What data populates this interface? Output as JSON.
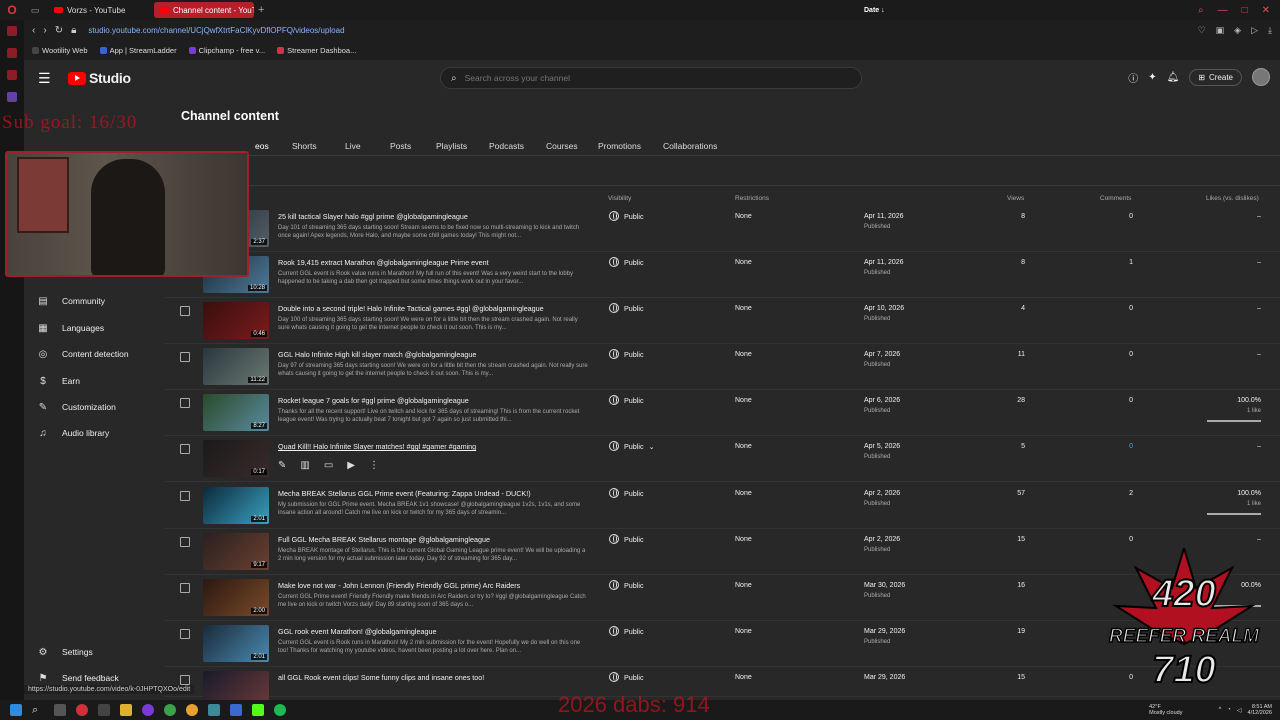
{
  "browser": {
    "tabs": [
      {
        "title": "Vorzs - YouTube"
      },
      {
        "title": "Channel content - YouTub"
      }
    ],
    "url": "studio.youtube.com/channel/UCjQwfXtrtFaClKyvDflOPFQ/videos/upload",
    "bookmarks": [
      "Wootility Web",
      "App | StreamLadder",
      "Clipchamp - free v...",
      "Streamer Dashboa..."
    ],
    "status_url": "https://studio.youtube.com/video/k-0JHPTQXOo/edit"
  },
  "header": {
    "brand": "Studio",
    "search_placeholder": "Search across your channel",
    "create_label": "Create"
  },
  "sidebar": {
    "items": [
      {
        "label": "Community",
        "icon": "community-icon"
      },
      {
        "label": "Languages",
        "icon": "languages-icon"
      },
      {
        "label": "Content detection",
        "icon": "content-detection-icon"
      },
      {
        "label": "Earn",
        "icon": "earn-icon"
      },
      {
        "label": "Customization",
        "icon": "customization-icon"
      },
      {
        "label": "Audio library",
        "icon": "audio-library-icon"
      }
    ],
    "settings": "Settings",
    "feedback": "Send feedback"
  },
  "page": {
    "title": "Channel content",
    "tabs": [
      "eos",
      "Shorts",
      "Live",
      "Posts",
      "Playlists",
      "Podcasts",
      "Courses",
      "Promotions",
      "Collaborations"
    ]
  },
  "columns": {
    "visibility": "Visibility",
    "restrictions": "Restrictions",
    "date": "Date",
    "views": "Views",
    "comments": "Comments",
    "likes": "Likes (vs. dislikes)"
  },
  "videos": [
    {
      "title": "25 kill tactical Slayer halo #ggl prime @globalgamingleague",
      "desc": "Day 101 of streaming 365 days starting soon! Stream seems to be fixed now so multi-streaming to kick and twitch once again! Apex legends, More Halo, and maybe some chill games today! This might not...",
      "duration": "2:37",
      "visibility": "Public",
      "restrictions": "None",
      "date": "Apr 11, 2026",
      "status": "Published",
      "views": "8",
      "comments": "0",
      "likes": "–",
      "likes_sub": ""
    },
    {
      "title": "Rook 19,415 extract Marathon @globalgamingleague Prime event",
      "desc": "Current GGL event is Rook value runs in Marathon! My full run of this event! Was a very weird start to the lobby happened to be taking a dab then got trapped but some times things work out in your favor...",
      "duration": "10:28",
      "visibility": "Public",
      "restrictions": "None",
      "date": "Apr 11, 2026",
      "status": "Published",
      "views": "8",
      "comments": "1",
      "likes": "–",
      "likes_sub": ""
    },
    {
      "title": "Double into a second triple! Halo Infinite Tactical games #ggl @globalgamingleague",
      "desc": "Day 100 of streaming 365 days starting soon! We were on for a little bit then the stream crashed again. Not really sure whats causing it going to get the internet people to check it out soon. This is my...",
      "duration": "0:46",
      "visibility": "Public",
      "restrictions": "None",
      "date": "Apr 10, 2026",
      "status": "Published",
      "views": "4",
      "comments": "0",
      "likes": "–",
      "likes_sub": ""
    },
    {
      "title": "GGL Halo Infinite High kill slayer match @globalgamingleague",
      "desc": "Day 97 of streaming 365 days starting soon! We were on for a little bit then the stream crashed again. Not really sure whats causing it going to get the internet people to check it out soon. This is my...",
      "duration": "11:22",
      "visibility": "Public",
      "restrictions": "None",
      "date": "Apr 7, 2026",
      "status": "Published",
      "views": "11",
      "comments": "0",
      "likes": "–",
      "likes_sub": ""
    },
    {
      "title": "Rocket league 7 goals for #ggl prime @globalgamingleague",
      "desc": "Thanks for all the recent support! Live on twitch and kick for 365 days of streaming! This is from the current rocket league event! Was trying to actually beat 7 tonight but got 7 again so just submitted thi...",
      "duration": "8:27",
      "visibility": "Public",
      "restrictions": "None",
      "date": "Apr 6, 2026",
      "status": "Published",
      "views": "28",
      "comments": "0",
      "likes": "100.0%",
      "likes_sub": "1 like"
    },
    {
      "title": "Quad Kill!! Halo Infinite Slayer matches! #ggl #gamer #gaming",
      "desc": "",
      "duration": "0:17",
      "visibility": "Public",
      "restrictions": "None",
      "date": "Apr 5, 2026",
      "status": "Published",
      "views": "5",
      "comments": "0",
      "likes": "–",
      "likes_sub": ""
    },
    {
      "title": "Mecha BREAK Stellarus GGL Prime event (Featuring: Zappa Undead - DUCK!)",
      "desc": "My submission for GGL Prime event. Mecha BREAK 1v1 showcase! @globalgamingleague 1v2s, 1v1s, and some insane action all around! Catch me live on kick or twitch for my 365 days of streamin...",
      "duration": "2:01",
      "visibility": "Public",
      "restrictions": "None",
      "date": "Apr 2, 2026",
      "status": "Published",
      "views": "57",
      "comments": "2",
      "likes": "100.0%",
      "likes_sub": "1 like"
    },
    {
      "title": "Full GGL Mecha BREAK Stellarus montage @globalgamingleague",
      "desc": "Mecha BREAK montage of Stellarus. This is the current Global Gaming League prime event! We will be uploading a 2 min long version for my actual submission later today. Day 92 of streaming for 365 day...",
      "duration": "9:17",
      "visibility": "Public",
      "restrictions": "None",
      "date": "Apr 2, 2026",
      "status": "Published",
      "views": "15",
      "comments": "0",
      "likes": "–",
      "likes_sub": ""
    },
    {
      "title": "Make love not war - John Lennon (Friendly Friendly GGL prime) Arc Raiders",
      "desc": "Current GGL Prime event! Friendly Friendly make friends in Arc Raiders or try to? #ggl @globalgamingleague Catch me live on kick or twitch Vorzs daily! Day 89 starting soon of 365 days o...",
      "duration": "2:00",
      "visibility": "Public",
      "restrictions": "None",
      "date": "Mar 30, 2026",
      "status": "Published",
      "views": "16",
      "comments": "",
      "likes": "00.0%",
      "likes_sub": ""
    },
    {
      "title": "GGL rook event Marathon! @globalgamingleague",
      "desc": "Current GGL event is Rook runs in Marathon! My 2 min submission for the event! Hopefully we do well on this one too! Thanks for watching my youtube videos, havent been posting a lot over here. Plan on...",
      "duration": "2:01",
      "visibility": "Public",
      "restrictions": "None",
      "date": "Mar 29, 2026",
      "status": "Published",
      "views": "19",
      "comments": "",
      "likes": "",
      "likes_sub": ""
    },
    {
      "title": "all GGL Rook event clips! Some funny clips and insane ones too!",
      "desc": "",
      "duration": "",
      "visibility": "Public",
      "restrictions": "None",
      "date": "Mar 29, 2026",
      "status": "",
      "views": "15",
      "comments": "0",
      "likes": "",
      "likes_sub": ""
    }
  ],
  "overlay": {
    "sub_goal": "Sub goal: 16/30",
    "dabs": "2026 dabs: 914",
    "logo_line1": "420",
    "logo_line2": "REEFER REALM",
    "logo_line3": "710"
  },
  "taskbar": {
    "temp": "42°F",
    "weather": "Mostly cloudy",
    "time": "8:51 AM",
    "date": "4/12/2026"
  }
}
